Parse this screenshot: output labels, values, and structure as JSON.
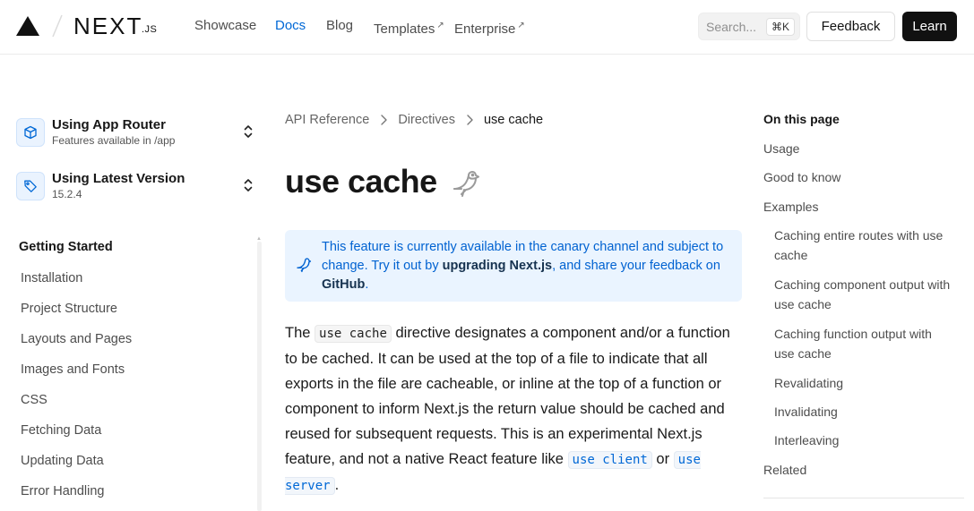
{
  "header": {
    "logo_word": "NEXT",
    "logo_suffix": ".JS",
    "nav": [
      {
        "label": "Showcase",
        "active": false,
        "external": false
      },
      {
        "label": "Docs",
        "active": true,
        "external": false
      },
      {
        "label": "Blog",
        "active": false,
        "external": false
      },
      {
        "label": "Templates",
        "active": false,
        "external": true
      },
      {
        "label": "Enterprise",
        "active": false,
        "external": true
      }
    ],
    "external_glyph": "↗",
    "search_placeholder": "Search...",
    "search_shortcut": "⌘K",
    "feedback_label": "Feedback",
    "learn_label": "Learn"
  },
  "sidebar": {
    "router": {
      "title": "Using App Router",
      "subtitle": "Features available in /app",
      "icon": "cube-icon"
    },
    "version": {
      "title": "Using Latest Version",
      "subtitle": "15.2.4",
      "icon": "tag-icon"
    },
    "section_title": "Getting Started",
    "items": [
      "Installation",
      "Project Structure",
      "Layouts and Pages",
      "Images and Fonts",
      "CSS",
      "Fetching Data",
      "Updating Data",
      "Error Handling"
    ]
  },
  "main": {
    "breadcrumb": [
      "API Reference",
      "Directives",
      "use cache"
    ],
    "title": "use cache",
    "title_icon": "canary-bird-icon",
    "callout": {
      "text_1": "This feature is currently available in the canary channel and subject to change. Try it out by ",
      "link_1": "upgrading Next.js",
      "text_2": ", and share your feedback on ",
      "link_2": "GitHub",
      "text_3": "."
    },
    "paragraph": {
      "t1": "The ",
      "c1": "use cache",
      "t2": " directive designates a component and/or a function to be cached. It can be used at the top of a file to indicate that all exports in the file are cacheable, or inline at the top of a function or component to inform Next.js the return value should be cached and reused for subsequent requests. This is an experimental Next.js feature, and not a native React feature like ",
      "c2": "use client",
      "t3": " or ",
      "c3": "use server",
      "t4": "."
    }
  },
  "toc": {
    "title": "On this page",
    "items": [
      {
        "label": "Usage",
        "level": 1
      },
      {
        "label": "Good to know",
        "level": 1
      },
      {
        "label": "Examples",
        "level": 1
      },
      {
        "label": "Caching entire routes with use cache",
        "level": 2
      },
      {
        "label": "Caching component output with use cache",
        "level": 2
      },
      {
        "label": "Caching function output with use cache",
        "level": 2
      },
      {
        "label": "Revalidating",
        "level": 2
      },
      {
        "label": "Invalidating",
        "level": 2
      },
      {
        "label": "Interleaving",
        "level": 2
      },
      {
        "label": "Related",
        "level": 1
      }
    ]
  },
  "colors": {
    "accent": "#0068d6",
    "callout_bg": "#eaf4ff",
    "text": "#171717",
    "muted": "#4d4d4d",
    "button_dark": "#111111"
  }
}
